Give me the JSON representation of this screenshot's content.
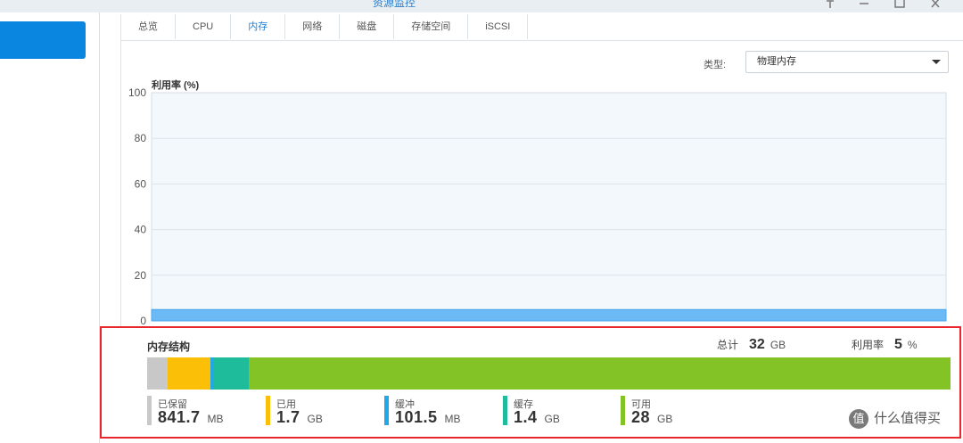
{
  "window": {
    "title": "资源监控",
    "controls": [
      "pin-icon",
      "minimize-icon",
      "maximize-icon",
      "close-icon"
    ]
  },
  "tabs": [
    {
      "label": "总览",
      "active": false
    },
    {
      "label": "CPU",
      "active": false
    },
    {
      "label": "内存",
      "active": true
    },
    {
      "label": "网络",
      "active": false
    },
    {
      "label": "磁盘",
      "active": false
    },
    {
      "label": "存储空间",
      "active": false
    },
    {
      "label": "iSCSI",
      "active": false
    }
  ],
  "type_selector": {
    "label": "类型:",
    "value": "物理内存"
  },
  "chart_data": {
    "type": "area",
    "title": "",
    "ylabel": "利用率 (%)",
    "xlabel": "",
    "ylim": [
      0,
      100
    ],
    "yticks": [
      "100",
      "80",
      "60",
      "40",
      "20",
      "0"
    ],
    "grid": true,
    "series": [
      {
        "values": [
          5,
          5,
          5,
          5,
          5,
          5,
          5,
          5,
          5,
          5,
          5,
          5,
          5,
          5,
          5,
          5,
          5,
          5,
          5,
          5,
          5,
          5,
          5,
          5,
          5,
          5,
          5,
          5,
          5,
          5,
          5,
          5,
          5,
          5,
          5,
          5,
          5,
          5,
          5,
          5,
          5,
          5,
          5,
          5,
          5,
          5,
          5,
          5,
          5,
          5,
          5,
          5,
          5,
          5,
          5,
          5,
          5,
          5,
          5,
          5
        ],
        "color": "#6bbaf5"
      }
    ]
  },
  "memory_structure": {
    "title": "内存结构",
    "total_label": "总计",
    "total_value": "32",
    "total_unit": "GB",
    "usage_label": "利用率",
    "usage_value": "5",
    "usage_unit": "%",
    "bar": [
      {
        "name": "reserved",
        "share": 0.026,
        "color": "#c8c8c8"
      },
      {
        "name": "used",
        "share": 0.053,
        "color": "#fbbf08"
      },
      {
        "name": "buffer",
        "share": 0.004,
        "color": "#22a8e8"
      },
      {
        "name": "cached",
        "share": 0.044,
        "color": "#1fbc9c"
      },
      {
        "name": "available",
        "share": 0.873,
        "color": "#84c326"
      }
    ],
    "legend": [
      {
        "label": "已保留",
        "value": "841.7",
        "unit": "MB",
        "color": "#c8c8c8"
      },
      {
        "label": "已用",
        "value": "1.7",
        "unit": "GB",
        "color": "#fbbf08"
      },
      {
        "label": "缓冲",
        "value": "101.5",
        "unit": "MB",
        "color": "#22a8e8"
      },
      {
        "label": "缓存",
        "value": "1.4",
        "unit": "GB",
        "color": "#1fbc9c"
      },
      {
        "label": "可用",
        "value": "28",
        "unit": "GB",
        "color": "#84c326"
      }
    ]
  },
  "watermark": {
    "logo": "值",
    "text": "什么值得买"
  }
}
